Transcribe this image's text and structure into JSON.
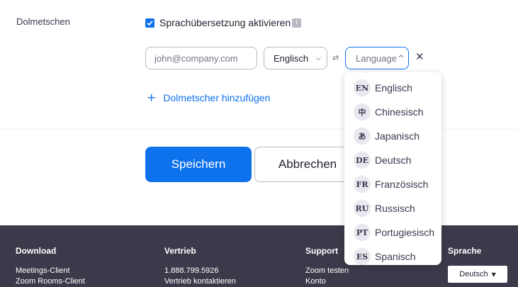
{
  "interpretation": {
    "section_label": "Dolmetschen",
    "enable_label": "Sprachübersetzung aktivieren",
    "info_icon_text": "i",
    "email_placeholder": "john@company.com",
    "source_language": "Englisch",
    "target_placeholder": "Language",
    "add_interpreter_label": "Dolmetscher hinzufügen"
  },
  "actions": {
    "save_label": "Speichern",
    "cancel_label": "Abbrechen"
  },
  "dropdown": {
    "items": [
      {
        "code": "EN",
        "label": "Englisch"
      },
      {
        "code": "中",
        "label": "Chinesisch"
      },
      {
        "code": "あ",
        "label": "Japanisch"
      },
      {
        "code": "DE",
        "label": "Deutsch"
      },
      {
        "code": "FR",
        "label": "Französisch"
      },
      {
        "code": "RU",
        "label": "Russisch"
      },
      {
        "code": "PT",
        "label": "Portugiesisch"
      },
      {
        "code": "ES",
        "label": "Spanisch"
      }
    ]
  },
  "footer": {
    "download": {
      "heading": "Download",
      "links": [
        "Meetings-Client",
        "Zoom Rooms-Client"
      ]
    },
    "sales": {
      "heading": "Vertrieb",
      "links": [
        "1.888.799.5926",
        "Vertrieb kontaktieren"
      ]
    },
    "support": {
      "heading": "Support",
      "links": [
        "Zoom testen",
        "Konto"
      ]
    },
    "language": {
      "heading": "Sprache",
      "current": "Deutsch"
    }
  },
  "colors": {
    "accent": "#0e72ed",
    "footer_bg": "#3a3a4a"
  }
}
